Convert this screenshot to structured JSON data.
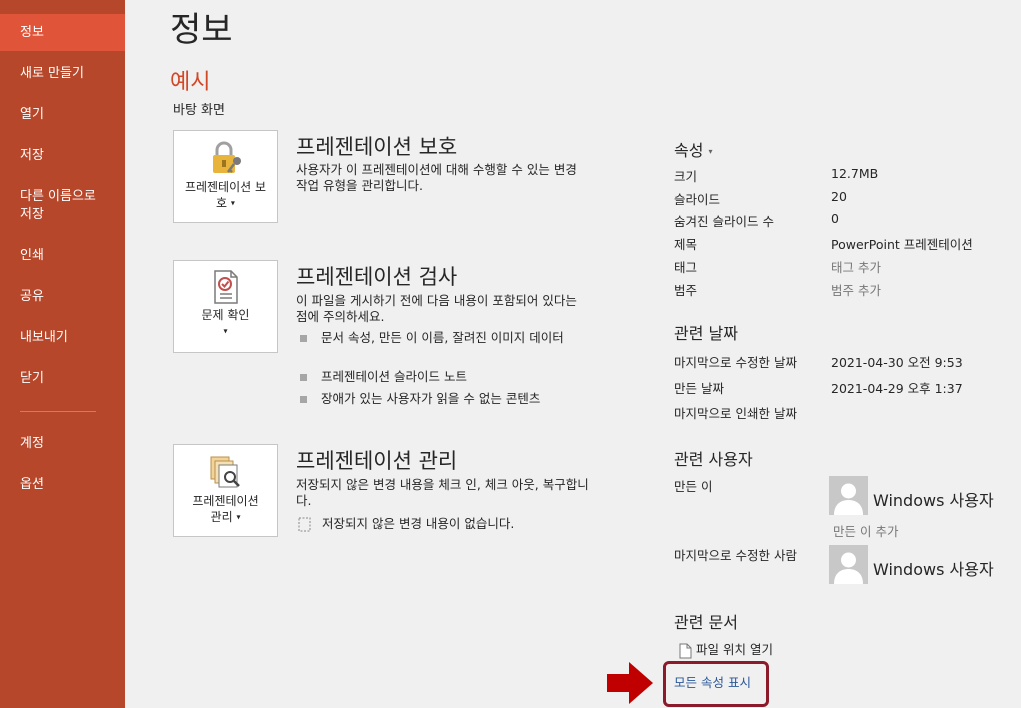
{
  "sidebar": {
    "items": [
      {
        "label": "정보",
        "active": true
      },
      {
        "label": "새로 만들기"
      },
      {
        "label": "열기"
      },
      {
        "label": "저장"
      },
      {
        "label": "다른 이름으로 저장"
      },
      {
        "label": "인쇄"
      },
      {
        "label": "공유"
      },
      {
        "label": "내보내기"
      },
      {
        "label": "닫기"
      },
      {
        "label": "계정"
      },
      {
        "label": "옵션"
      }
    ]
  },
  "main": {
    "title": "정보",
    "doc_name": "예시",
    "doc_location": "바탕 화면",
    "sections": [
      {
        "tile_label": "프레젠테이션 보호",
        "icon": "lock-key-icon",
        "title": "프레젠테이션 보호",
        "desc": "사용자가 이 프레젠테이션에 대해 수행할 수 있는 변경 작업 유형을 관리합니다."
      },
      {
        "tile_label": "문제 확인",
        "icon": "checklist-icon",
        "title": "프레젠테이션 검사",
        "desc": "이 파일을 게시하기 전에 다음 내용이 포함되어 있다는 점에 주의하세요.",
        "bullets": [
          "문서 속성, 만든 이 이름, 잘려진 이미지 데이터",
          "프레젠테이션 슬라이드 노트",
          "장애가 있는 사용자가 읽을 수 없는 콘텐츠"
        ]
      },
      {
        "tile_label": "프레젠테이션 관리",
        "icon": "manage-versions-icon",
        "title": "프레젠테이션 관리",
        "desc": "저장되지 않은 변경 내용을 체크 인, 체크 아웃, 복구합니다.",
        "note": "저장되지 않은 변경 내용이 없습니다."
      }
    ]
  },
  "properties": {
    "header": "속성",
    "rows": [
      {
        "label": "크기",
        "value": "12.7MB"
      },
      {
        "label": "슬라이드",
        "value": "20"
      },
      {
        "label": "숨겨진 슬라이드 수",
        "value": "0"
      },
      {
        "label": "제목",
        "value": "PowerPoint 프레젠테이션"
      },
      {
        "label": "태그",
        "value": "태그 추가"
      },
      {
        "label": "범주",
        "value": "범주 추가"
      }
    ],
    "dates_header": "관련 날짜",
    "dates": [
      {
        "label": "마지막으로 수정한 날짜",
        "value": "2021-04-30 오전 9:53"
      },
      {
        "label": "만든 날짜",
        "value": "2021-04-29 오후 1:37"
      },
      {
        "label": "마지막으로 인쇄한 날짜",
        "value": ""
      }
    ],
    "people_header": "관련 사용자",
    "author_label": "만든 이",
    "author_name": "Windows 사용자",
    "add_author": "만든 이 추가",
    "modified_by_label": "마지막으로 수정한 사람",
    "modified_by_name": "Windows 사용자",
    "docs_header": "관련 문서",
    "open_location": "파일 위치 열기",
    "show_all": "모든 속성 표시"
  },
  "colors": {
    "sidebar": "#b7472a",
    "sidebar_active": "#e0553a",
    "accent": "#d24726",
    "highlight_box": "#8b1a2a",
    "arrow": "#c00000",
    "link": "#2b579a"
  }
}
